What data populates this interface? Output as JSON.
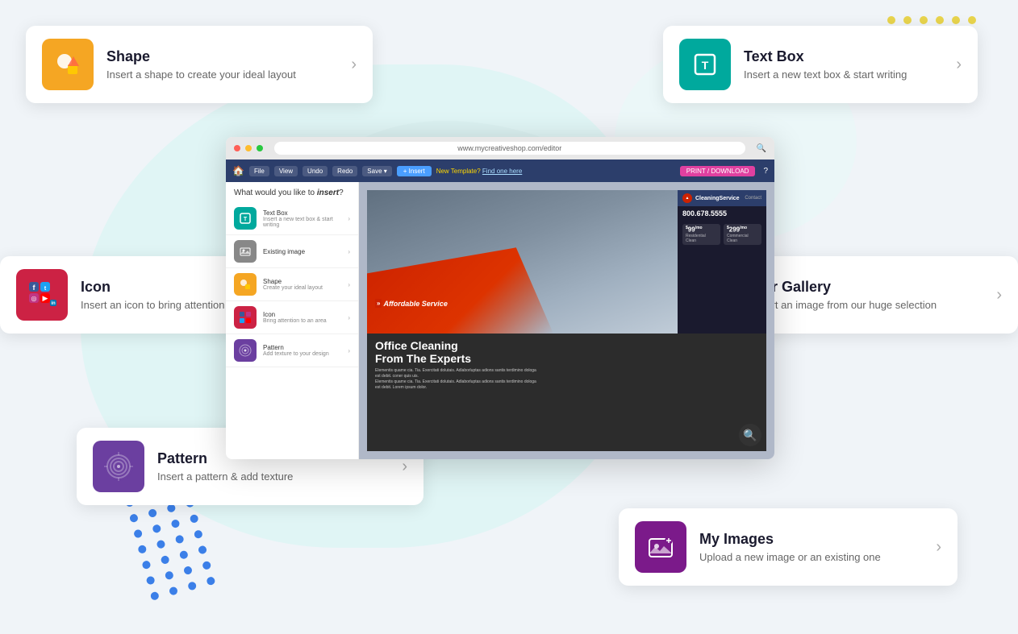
{
  "background": {
    "blob_color_1": "#e0f5f5",
    "blob_color_2": "#d8f0f0"
  },
  "cards": {
    "shape": {
      "title": "Shape",
      "desc": "Insert a shape to create your ideal layout",
      "icon_bg": "#f5a623",
      "arrow": "›"
    },
    "textbox": {
      "title": "Text Box",
      "desc": "Insert a new text box & start writing",
      "icon_bg": "#00a99d",
      "arrow": "›"
    },
    "icon": {
      "title": "Icon",
      "desc": "Insert an icon to bring attention to an area",
      "icon_bg": "#cc2244",
      "arrow": "›"
    },
    "gallery": {
      "title": "Our Gallery",
      "desc": "Insert an image from our huge selection",
      "icon_bg": "#1a1a2e",
      "arrow": "›"
    },
    "pattern": {
      "title": "Pattern",
      "desc": "Insert a pattern & add texture",
      "icon_bg": "#6b3fa0",
      "arrow": "›"
    },
    "myimages": {
      "title": "My Images",
      "desc": "Upload a new image or an existing one",
      "icon_bg": "#7b1a8a",
      "arrow": "›"
    }
  },
  "browser": {
    "url": "www.mycreativeshop.com/editor",
    "toolbar": {
      "insert_label": "+ Insert",
      "print_label": "PRINT / DOWNLOAD",
      "template_label": "New Template?",
      "find_here": "Find one here"
    }
  },
  "insert_panel": {
    "title": "What would you like to ",
    "title_em": "insert",
    "title_end": "?",
    "items": [
      {
        "label": "Text Box",
        "sub": "Insert a new text box & start writing",
        "icon_bg": "#00a99d"
      },
      {
        "label": "Existing image",
        "sub": "",
        "icon_bg": "#888"
      },
      {
        "label": "Shape",
        "sub": "Create your ideal layout",
        "icon_bg": "#f5a623"
      },
      {
        "label": "Icon",
        "sub": "Bring attention to an area",
        "icon_bg": "#cc2244"
      },
      {
        "label": "Pattern",
        "sub": "Add texture to your design",
        "icon_bg": "#6b3fa0"
      }
    ]
  },
  "flyer": {
    "brand": "CleaningService",
    "phone": "800.678.5555",
    "price1": "$99",
    "price1_label": "Residential Clean",
    "price2": "$299",
    "price2_label": "Commercial Clean",
    "headline_line1": "Office Cleaning",
    "headline_line2": "From The Experts",
    "contact": "Contact"
  }
}
